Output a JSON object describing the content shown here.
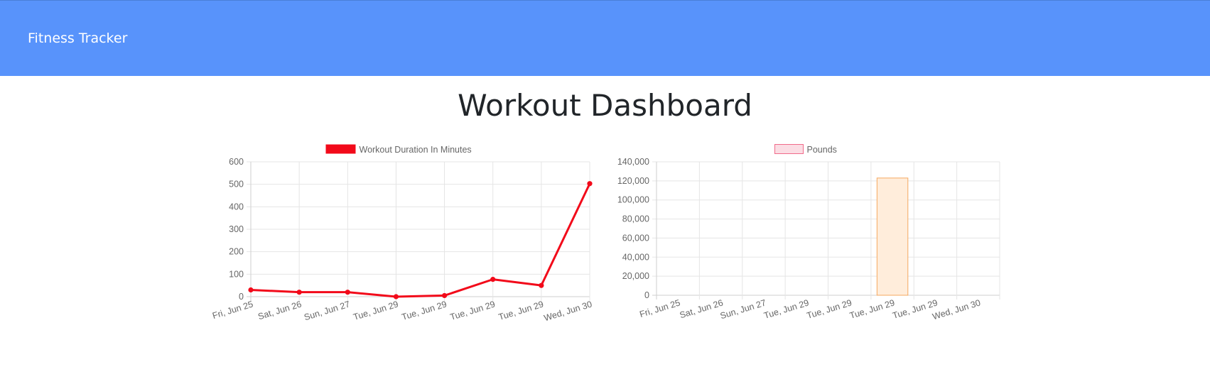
{
  "navbar": {
    "brand": "Fitness Tracker"
  },
  "page": {
    "title": "Workout Dashboard"
  },
  "colors": {
    "navbar_bg": "#5893fb",
    "duration_line": "#f20a1a",
    "pounds_bar_fill": "#ffeddb",
    "pounds_bar_stroke": "#f6a85f",
    "pounds_legend_fill": "#fbdde4",
    "pounds_legend_stroke": "#f06b8a",
    "grid": "#e5e5e5"
  },
  "chart_data": [
    {
      "type": "line",
      "legend": "Workout Duration In Minutes",
      "legend_position": "top",
      "categories": [
        "Fri, Jun 25",
        "Sat, Jun 26",
        "Sun, Jun 27",
        "Tue, Jun 29",
        "Tue, Jun 29",
        "Tue, Jun 29",
        "Tue, Jun 29",
        "Wed, Jun 30"
      ],
      "series": [
        {
          "name": "Workout Duration In Minutes",
          "values": [
            30,
            20,
            20,
            0,
            5,
            77,
            50,
            503
          ]
        }
      ],
      "yticks": [
        "600",
        "500",
        "400",
        "300",
        "200",
        "100",
        "0"
      ],
      "ylim": [
        0,
        600
      ],
      "grid": true
    },
    {
      "type": "bar",
      "legend": "Pounds",
      "legend_position": "top",
      "categories": [
        "Fri, Jun 25",
        "Sat, Jun 26",
        "Sun, Jun 27",
        "Tue, Jun 29",
        "Tue, Jun 29",
        "Tue, Jun 29",
        "Tue, Jun 29",
        "Wed, Jun 30"
      ],
      "series": [
        {
          "name": "Pounds",
          "values": [
            0,
            0,
            0,
            0,
            0,
            123000,
            0,
            0
          ]
        }
      ],
      "yticks": [
        "140,000",
        "120,000",
        "100,000",
        "80,000",
        "60,000",
        "40,000",
        "20,000",
        "0"
      ],
      "ylim": [
        0,
        140000
      ],
      "grid": true
    }
  ]
}
